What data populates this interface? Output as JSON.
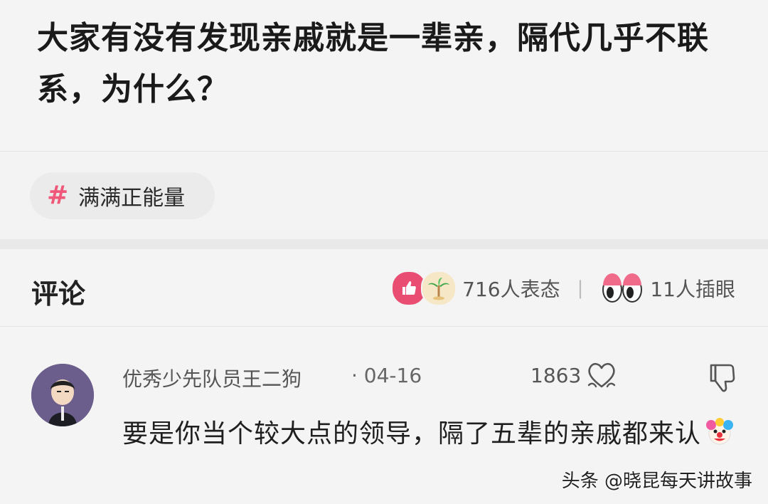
{
  "question": {
    "title": "大家有没有发现亲戚就是一辈亲，隔代几乎不联系，为什么？"
  },
  "topic": {
    "hash_symbol": "#",
    "label": "满满正能量"
  },
  "comments_section": {
    "title": "评论",
    "reactions": {
      "react_count_text": "716人表态",
      "separator": "|",
      "eye_count_text": "11人插眼",
      "icons": [
        "thumbs-up-icon",
        "palm-tree-icon",
        "eyes-icon"
      ]
    }
  },
  "comment": {
    "username": "优秀少先队员王二狗",
    "date": "· 04-16",
    "like_count": "1863",
    "body": "要是你当个较大点的领导，隔了五辈的亲戚都来认",
    "emoji": "clown-icon"
  },
  "watermark": "头条 @晓昆每天讲故事",
  "colors": {
    "accent_pink": "#ea4d72",
    "hash_pink": "#f0587a",
    "background": "#f4f4f4"
  }
}
